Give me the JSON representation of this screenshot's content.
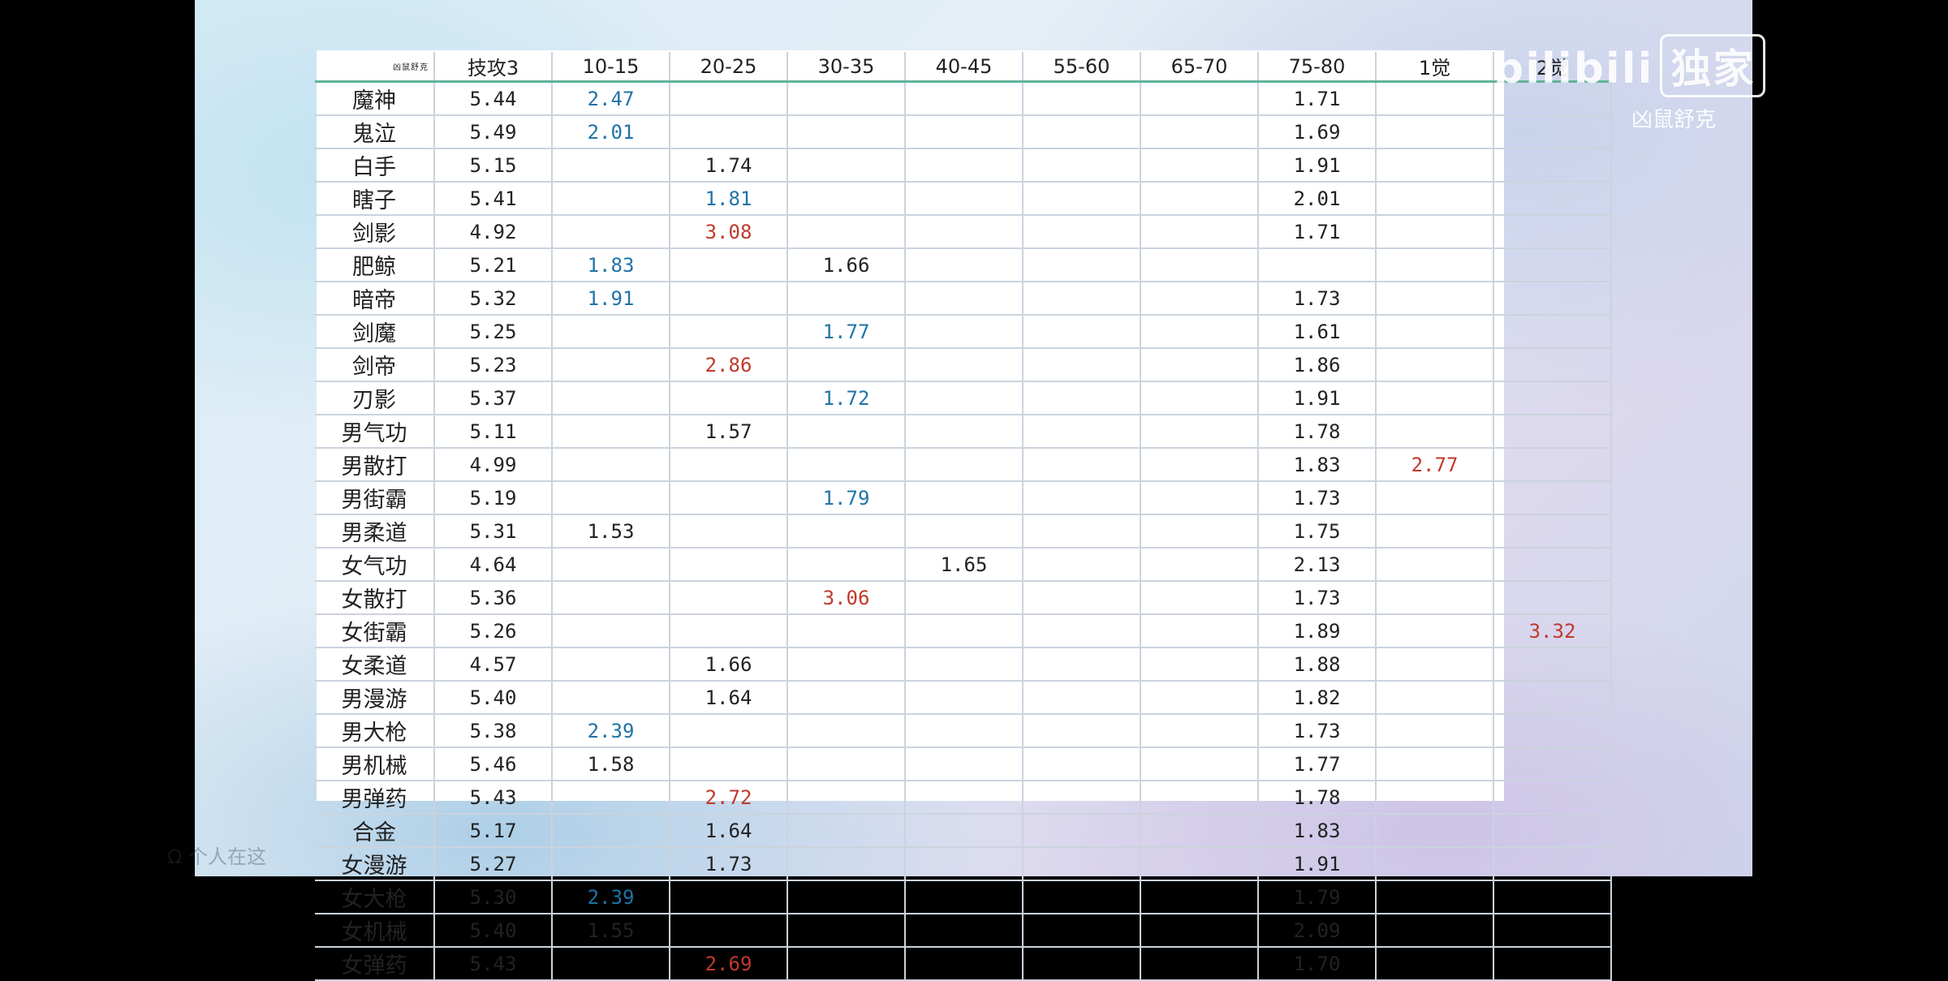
{
  "watermark": {
    "logo_text": "bilibili",
    "logo_badge": "独家",
    "user": "凶鼠舒克",
    "bottom": "Ω 个人在这"
  },
  "table": {
    "corner_label": "凶鼠舒克",
    "headers": [
      "技攻3",
      "10-15",
      "20-25",
      "30-35",
      "40-45",
      "55-60",
      "65-70",
      "75-80",
      "1觉",
      "2觉"
    ],
    "rows": [
      {
        "name": "魔神",
        "cells": [
          {
            "v": "5.44"
          },
          {
            "v": "2.47",
            "c": "blue"
          },
          {
            "v": ""
          },
          {
            "v": ""
          },
          {
            "v": ""
          },
          {
            "v": ""
          },
          {
            "v": ""
          },
          {
            "v": "1.71"
          },
          {
            "v": ""
          },
          {
            "v": ""
          }
        ]
      },
      {
        "name": "鬼泣",
        "cells": [
          {
            "v": "5.49"
          },
          {
            "v": "2.01",
            "c": "blue"
          },
          {
            "v": ""
          },
          {
            "v": ""
          },
          {
            "v": ""
          },
          {
            "v": ""
          },
          {
            "v": ""
          },
          {
            "v": "1.69"
          },
          {
            "v": ""
          },
          {
            "v": ""
          }
        ]
      },
      {
        "name": "白手",
        "cells": [
          {
            "v": "5.15"
          },
          {
            "v": ""
          },
          {
            "v": "1.74"
          },
          {
            "v": ""
          },
          {
            "v": ""
          },
          {
            "v": ""
          },
          {
            "v": ""
          },
          {
            "v": "1.91"
          },
          {
            "v": ""
          },
          {
            "v": ""
          }
        ]
      },
      {
        "name": "瞎子",
        "cells": [
          {
            "v": "5.41"
          },
          {
            "v": ""
          },
          {
            "v": "1.81",
            "c": "blue"
          },
          {
            "v": ""
          },
          {
            "v": ""
          },
          {
            "v": ""
          },
          {
            "v": ""
          },
          {
            "v": "2.01"
          },
          {
            "v": ""
          },
          {
            "v": ""
          }
        ]
      },
      {
        "name": "剑影",
        "cells": [
          {
            "v": "4.92"
          },
          {
            "v": ""
          },
          {
            "v": "3.08",
            "c": "red"
          },
          {
            "v": ""
          },
          {
            "v": ""
          },
          {
            "v": ""
          },
          {
            "v": ""
          },
          {
            "v": "1.71"
          },
          {
            "v": ""
          },
          {
            "v": ""
          }
        ]
      },
      {
        "name": "肥鲸",
        "cells": [
          {
            "v": "5.21"
          },
          {
            "v": "1.83",
            "c": "blue"
          },
          {
            "v": ""
          },
          {
            "v": "1.66"
          },
          {
            "v": ""
          },
          {
            "v": ""
          },
          {
            "v": ""
          },
          {
            "v": ""
          },
          {
            "v": ""
          },
          {
            "v": ""
          }
        ]
      },
      {
        "name": "暗帝",
        "cells": [
          {
            "v": "5.32"
          },
          {
            "v": "1.91",
            "c": "blue"
          },
          {
            "v": ""
          },
          {
            "v": ""
          },
          {
            "v": ""
          },
          {
            "v": ""
          },
          {
            "v": ""
          },
          {
            "v": "1.73"
          },
          {
            "v": ""
          },
          {
            "v": ""
          }
        ]
      },
      {
        "name": "剑魔",
        "cells": [
          {
            "v": "5.25"
          },
          {
            "v": ""
          },
          {
            "v": ""
          },
          {
            "v": "1.77",
            "c": "blue"
          },
          {
            "v": ""
          },
          {
            "v": ""
          },
          {
            "v": ""
          },
          {
            "v": "1.61"
          },
          {
            "v": ""
          },
          {
            "v": ""
          }
        ]
      },
      {
        "name": "剑帝",
        "cells": [
          {
            "v": "5.23"
          },
          {
            "v": ""
          },
          {
            "v": "2.86",
            "c": "red"
          },
          {
            "v": ""
          },
          {
            "v": ""
          },
          {
            "v": ""
          },
          {
            "v": ""
          },
          {
            "v": "1.86"
          },
          {
            "v": ""
          },
          {
            "v": ""
          }
        ]
      },
      {
        "name": "刃影",
        "cells": [
          {
            "v": "5.37"
          },
          {
            "v": ""
          },
          {
            "v": ""
          },
          {
            "v": "1.72",
            "c": "blue"
          },
          {
            "v": ""
          },
          {
            "v": ""
          },
          {
            "v": ""
          },
          {
            "v": "1.91"
          },
          {
            "v": ""
          },
          {
            "v": ""
          }
        ]
      },
      {
        "name": "男气功",
        "cells": [
          {
            "v": "5.11"
          },
          {
            "v": ""
          },
          {
            "v": "1.57"
          },
          {
            "v": ""
          },
          {
            "v": ""
          },
          {
            "v": ""
          },
          {
            "v": ""
          },
          {
            "v": "1.78"
          },
          {
            "v": ""
          },
          {
            "v": ""
          }
        ]
      },
      {
        "name": "男散打",
        "cells": [
          {
            "v": "4.99"
          },
          {
            "v": ""
          },
          {
            "v": ""
          },
          {
            "v": ""
          },
          {
            "v": ""
          },
          {
            "v": ""
          },
          {
            "v": ""
          },
          {
            "v": "1.83"
          },
          {
            "v": "2.77",
            "c": "red"
          },
          {
            "v": ""
          }
        ]
      },
      {
        "name": "男街霸",
        "cells": [
          {
            "v": "5.19"
          },
          {
            "v": ""
          },
          {
            "v": ""
          },
          {
            "v": "1.79",
            "c": "blue"
          },
          {
            "v": ""
          },
          {
            "v": ""
          },
          {
            "v": ""
          },
          {
            "v": "1.73"
          },
          {
            "v": ""
          },
          {
            "v": ""
          }
        ]
      },
      {
        "name": "男柔道",
        "cells": [
          {
            "v": "5.31"
          },
          {
            "v": "1.53"
          },
          {
            "v": ""
          },
          {
            "v": ""
          },
          {
            "v": ""
          },
          {
            "v": ""
          },
          {
            "v": ""
          },
          {
            "v": "1.75"
          },
          {
            "v": ""
          },
          {
            "v": ""
          }
        ]
      },
      {
        "name": "女气功",
        "cells": [
          {
            "v": "4.64"
          },
          {
            "v": ""
          },
          {
            "v": ""
          },
          {
            "v": ""
          },
          {
            "v": "1.65"
          },
          {
            "v": ""
          },
          {
            "v": ""
          },
          {
            "v": "2.13"
          },
          {
            "v": ""
          },
          {
            "v": ""
          }
        ]
      },
      {
        "name": "女散打",
        "cells": [
          {
            "v": "5.36"
          },
          {
            "v": ""
          },
          {
            "v": ""
          },
          {
            "v": "3.06",
            "c": "red"
          },
          {
            "v": ""
          },
          {
            "v": ""
          },
          {
            "v": ""
          },
          {
            "v": "1.73"
          },
          {
            "v": ""
          },
          {
            "v": ""
          }
        ]
      },
      {
        "name": "女街霸",
        "cells": [
          {
            "v": "5.26"
          },
          {
            "v": ""
          },
          {
            "v": ""
          },
          {
            "v": ""
          },
          {
            "v": ""
          },
          {
            "v": ""
          },
          {
            "v": ""
          },
          {
            "v": "1.89"
          },
          {
            "v": ""
          },
          {
            "v": "3.32",
            "c": "red"
          }
        ]
      },
      {
        "name": "女柔道",
        "cells": [
          {
            "v": "4.57"
          },
          {
            "v": ""
          },
          {
            "v": "1.66"
          },
          {
            "v": ""
          },
          {
            "v": ""
          },
          {
            "v": ""
          },
          {
            "v": ""
          },
          {
            "v": "1.88"
          },
          {
            "v": ""
          },
          {
            "v": ""
          }
        ]
      },
      {
        "name": "男漫游",
        "cells": [
          {
            "v": "5.40"
          },
          {
            "v": ""
          },
          {
            "v": "1.64"
          },
          {
            "v": ""
          },
          {
            "v": ""
          },
          {
            "v": ""
          },
          {
            "v": ""
          },
          {
            "v": "1.82"
          },
          {
            "v": ""
          },
          {
            "v": ""
          }
        ]
      },
      {
        "name": "男大枪",
        "cells": [
          {
            "v": "5.38"
          },
          {
            "v": "2.39",
            "c": "blue"
          },
          {
            "v": ""
          },
          {
            "v": ""
          },
          {
            "v": ""
          },
          {
            "v": ""
          },
          {
            "v": ""
          },
          {
            "v": "1.73"
          },
          {
            "v": ""
          },
          {
            "v": ""
          }
        ]
      },
      {
        "name": "男机械",
        "cells": [
          {
            "v": "5.46"
          },
          {
            "v": "1.58"
          },
          {
            "v": ""
          },
          {
            "v": ""
          },
          {
            "v": ""
          },
          {
            "v": ""
          },
          {
            "v": ""
          },
          {
            "v": "1.77"
          },
          {
            "v": ""
          },
          {
            "v": ""
          }
        ]
      },
      {
        "name": "男弹药",
        "cells": [
          {
            "v": "5.43"
          },
          {
            "v": ""
          },
          {
            "v": "2.72",
            "c": "red"
          },
          {
            "v": ""
          },
          {
            "v": ""
          },
          {
            "v": ""
          },
          {
            "v": ""
          },
          {
            "v": "1.78"
          },
          {
            "v": ""
          },
          {
            "v": ""
          }
        ]
      },
      {
        "name": "合金",
        "cells": [
          {
            "v": "5.17"
          },
          {
            "v": ""
          },
          {
            "v": "1.64"
          },
          {
            "v": ""
          },
          {
            "v": ""
          },
          {
            "v": ""
          },
          {
            "v": ""
          },
          {
            "v": "1.83"
          },
          {
            "v": ""
          },
          {
            "v": ""
          }
        ]
      },
      {
        "name": "女漫游",
        "cells": [
          {
            "v": "5.27"
          },
          {
            "v": ""
          },
          {
            "v": "1.73"
          },
          {
            "v": ""
          },
          {
            "v": ""
          },
          {
            "v": ""
          },
          {
            "v": ""
          },
          {
            "v": "1.91"
          },
          {
            "v": ""
          },
          {
            "v": ""
          }
        ]
      },
      {
        "name": "女大枪",
        "cells": [
          {
            "v": "5.30"
          },
          {
            "v": "2.39",
            "c": "blue"
          },
          {
            "v": ""
          },
          {
            "v": ""
          },
          {
            "v": ""
          },
          {
            "v": ""
          },
          {
            "v": ""
          },
          {
            "v": "1.79"
          },
          {
            "v": ""
          },
          {
            "v": ""
          }
        ]
      },
      {
        "name": "女机械",
        "cells": [
          {
            "v": "5.40"
          },
          {
            "v": "1.55"
          },
          {
            "v": ""
          },
          {
            "v": ""
          },
          {
            "v": ""
          },
          {
            "v": ""
          },
          {
            "v": ""
          },
          {
            "v": "2.09"
          },
          {
            "v": ""
          },
          {
            "v": ""
          }
        ]
      },
      {
        "name": "女弹药",
        "cells": [
          {
            "v": "5.43"
          },
          {
            "v": ""
          },
          {
            "v": "2.69",
            "c": "red"
          },
          {
            "v": ""
          },
          {
            "v": ""
          },
          {
            "v": ""
          },
          {
            "v": ""
          },
          {
            "v": "1.70"
          },
          {
            "v": ""
          },
          {
            "v": ""
          }
        ]
      }
    ]
  },
  "colors": {
    "highlight_blue": "#1f73a6",
    "highlight_red": "#c0392b",
    "header_rule": "#5fb39a"
  }
}
